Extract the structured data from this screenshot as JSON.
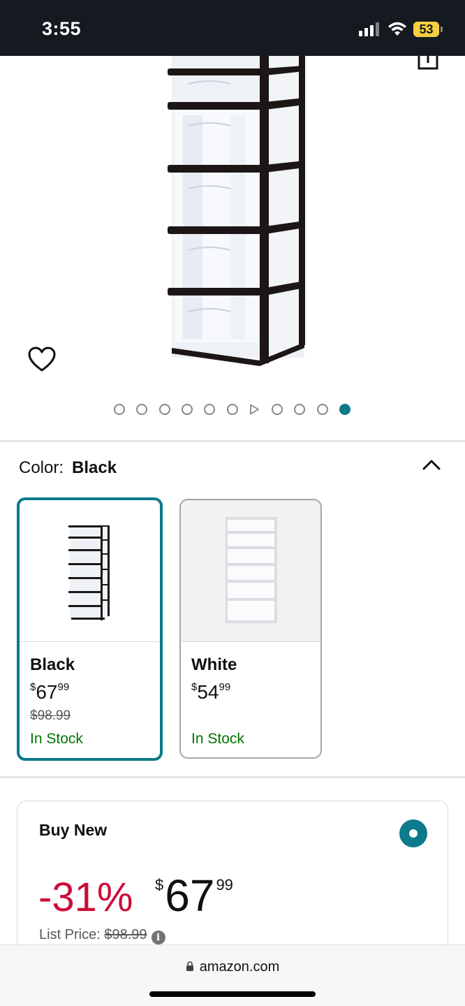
{
  "status_bar": {
    "time": "3:55",
    "battery": "53",
    "icons": [
      "signal-icon",
      "wifi-icon",
      "battery-icon"
    ]
  },
  "product": {
    "image_alt": "7-drawer plastic storage tower, black frame with clear drawers",
    "carousel": {
      "total_slides": 11,
      "video_slide_index": 6,
      "active_index": 10
    }
  },
  "color_section": {
    "label": "Color:",
    "selected": "Black",
    "options": [
      {
        "name": "Black",
        "price_symbol": "$",
        "price_whole": "67",
        "price_fraction": "99",
        "list_price": "$98.99",
        "stock": "In Stock",
        "selected": true
      },
      {
        "name": "White",
        "price_symbol": "$",
        "price_whole": "54",
        "price_fraction": "99",
        "list_price": "",
        "stock": "In Stock",
        "selected": false
      }
    ]
  },
  "buy_new": {
    "title": "Buy New",
    "discount": "-31%",
    "price_symbol": "$",
    "price_whole": "67",
    "price_fraction": "99",
    "list_price_label": "List Price:",
    "list_price": "$98.99",
    "selected": true
  },
  "browser": {
    "url": "amazon.com"
  },
  "colors": {
    "status_bar_bg": "#151a21",
    "accent_teal": "#0b7a8a",
    "discount_red": "#cc0c39",
    "in_stock_green": "#007600",
    "battery_yellow": "#f4d03f"
  }
}
